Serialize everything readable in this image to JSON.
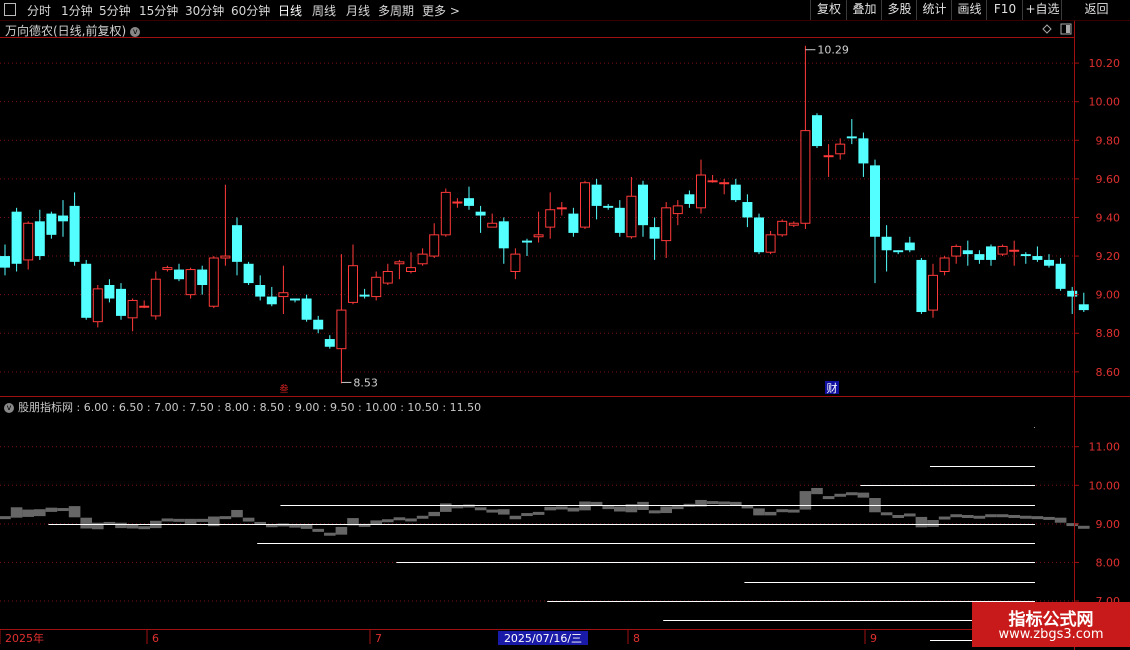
{
  "toolbar": {
    "periods": [
      "分时",
      "1分钟",
      "5分钟",
      "15分钟",
      "30分钟",
      "60分钟",
      "日线",
      "周线",
      "月线",
      "多周期",
      "更多"
    ],
    "active": "日线",
    "right_buttons": [
      "复权",
      "叠加",
      "多股",
      "统计",
      "画线",
      "F10",
      "+自选",
      "返回"
    ]
  },
  "main": {
    "title": "万向德农(日线,前复权)",
    "y_ticks": [
      "10.20",
      "10.00",
      "9.80",
      "9.60",
      "9.40",
      "9.20",
      "9.00",
      "8.80",
      "8.60"
    ],
    "high_label": "10.29",
    "low_label": "8.53",
    "event_marker": "财",
    "cross_marker": "叁",
    "colors": {
      "up": "#ff3a3a",
      "down": "#54ffff",
      "grid": "#7a1010",
      "axis": "#a01010"
    }
  },
  "sub": {
    "title": "股朋指标网 : 6.00 : 6.50 : 7.00 : 7.50 : 8.00 : 8.50 : 9.00 : 9.50 : 10.00 : 10.50 : 11.50",
    "y_ticks": [
      "11.00",
      "10.00",
      "9.00",
      "8.00",
      "7.00"
    ],
    "colors": {
      "bars": "#666666",
      "lines": "#ffffff"
    }
  },
  "x_axis": {
    "labels": [
      "2025年",
      "6",
      "7",
      "8",
      "9"
    ],
    "cursor_date": "2025/07/16/三"
  },
  "watermark": {
    "line1": "指标公式网",
    "line2": "www.zbgs3.com"
  },
  "chart_data": [
    {
      "type": "candlestick",
      "title": "万向德农(日线,前复权)",
      "ylim": [
        8.48,
        10.33
      ],
      "candles": [
        [
          9.2,
          9.14,
          9.26,
          9.1
        ],
        [
          9.43,
          9.16,
          9.45,
          9.12
        ],
        [
          9.18,
          9.37,
          9.38,
          9.13
        ],
        [
          9.38,
          9.2,
          9.44,
          9.18
        ],
        [
          9.42,
          9.31,
          9.43,
          9.29
        ],
        [
          9.41,
          9.38,
          9.49,
          9.3
        ],
        [
          9.46,
          9.17,
          9.53,
          9.15
        ],
        [
          9.16,
          8.88,
          9.18,
          8.87
        ],
        [
          8.86,
          9.03,
          9.05,
          8.83
        ],
        [
          9.05,
          8.98,
          9.08,
          8.96
        ],
        [
          9.03,
          8.89,
          9.06,
          8.87
        ],
        [
          8.88,
          8.97,
          8.98,
          8.81
        ],
        [
          8.94,
          8.94,
          8.97,
          8.93
        ],
        [
          8.89,
          9.08,
          9.12,
          8.87
        ],
        [
          9.13,
          9.14,
          9.15,
          9.12
        ],
        [
          9.13,
          9.08,
          9.16,
          9.07
        ],
        [
          9.0,
          9.13,
          9.14,
          8.98
        ],
        [
          9.13,
          9.05,
          9.15,
          9.0
        ],
        [
          8.94,
          9.19,
          9.2,
          8.93
        ],
        [
          9.19,
          9.2,
          9.57,
          9.15
        ],
        [
          9.36,
          9.17,
          9.4,
          9.1
        ],
        [
          9.16,
          9.06,
          9.17,
          9.05
        ],
        [
          9.05,
          8.99,
          9.1,
          8.97
        ],
        [
          8.99,
          8.95,
          9.04,
          8.94
        ],
        [
          8.99,
          9.01,
          9.15,
          8.9
        ],
        [
          8.98,
          8.97,
          8.98,
          8.96
        ],
        [
          8.98,
          8.87,
          9.0,
          8.86
        ],
        [
          8.87,
          8.82,
          8.89,
          8.8
        ],
        [
          8.77,
          8.73,
          8.79,
          8.72
        ],
        [
          8.72,
          8.92,
          9.21,
          8.54
        ],
        [
          8.96,
          9.15,
          9.26,
          8.95
        ],
        [
          9.0,
          8.99,
          9.03,
          8.98
        ],
        [
          8.99,
          9.09,
          9.12,
          8.97
        ],
        [
          9.06,
          9.12,
          9.16,
          9.05
        ],
        [
          9.16,
          9.17,
          9.18,
          9.08
        ],
        [
          9.12,
          9.14,
          9.22,
          9.11
        ],
        [
          9.16,
          9.21,
          9.24,
          9.15
        ],
        [
          9.2,
          9.31,
          9.37,
          9.19
        ],
        [
          9.31,
          9.53,
          9.55,
          9.3
        ],
        [
          9.48,
          9.48,
          9.5,
          9.45
        ],
        [
          9.5,
          9.46,
          9.56,
          9.44
        ],
        [
          9.43,
          9.41,
          9.46,
          9.32
        ],
        [
          9.35,
          9.37,
          9.42,
          9.36
        ],
        [
          9.38,
          9.24,
          9.4,
          9.16
        ],
        [
          9.12,
          9.21,
          9.24,
          9.08
        ],
        [
          9.28,
          9.27,
          9.29,
          9.2
        ],
        [
          9.3,
          9.31,
          9.43,
          9.27
        ],
        [
          9.35,
          9.44,
          9.53,
          9.29
        ],
        [
          9.45,
          9.45,
          9.48,
          9.41
        ],
        [
          9.42,
          9.32,
          9.45,
          9.3
        ],
        [
          9.35,
          9.58,
          9.59,
          9.34
        ],
        [
          9.57,
          9.46,
          9.6,
          9.39
        ],
        [
          9.46,
          9.45,
          9.47,
          9.44
        ],
        [
          9.45,
          9.32,
          9.49,
          9.3
        ],
        [
          9.3,
          9.51,
          9.61,
          9.29
        ],
        [
          9.57,
          9.36,
          9.59,
          9.3
        ],
        [
          9.35,
          9.29,
          9.4,
          9.18
        ],
        [
          9.28,
          9.45,
          9.48,
          9.19
        ],
        [
          9.42,
          9.46,
          9.49,
          9.36
        ],
        [
          9.52,
          9.47,
          9.54,
          9.45
        ],
        [
          9.45,
          9.62,
          9.7,
          9.42
        ],
        [
          9.59,
          9.59,
          9.62,
          9.58
        ],
        [
          9.58,
          9.58,
          9.6,
          9.52
        ],
        [
          9.57,
          9.49,
          9.6,
          9.48
        ],
        [
          9.48,
          9.4,
          9.52,
          9.35
        ],
        [
          9.4,
          9.22,
          9.42,
          9.21
        ],
        [
          9.22,
          9.31,
          9.33,
          9.21
        ],
        [
          9.31,
          9.38,
          9.39,
          9.3
        ],
        [
          9.36,
          9.37,
          9.38,
          9.35
        ],
        [
          9.37,
          9.85,
          10.29,
          9.34
        ],
        [
          9.93,
          9.77,
          9.94,
          9.76
        ],
        [
          9.72,
          9.72,
          9.78,
          9.61
        ],
        [
          9.73,
          9.78,
          9.81,
          9.7
        ],
        [
          9.82,
          9.81,
          9.91,
          9.78
        ],
        [
          9.81,
          9.68,
          9.84,
          9.61
        ],
        [
          9.67,
          9.3,
          9.7,
          9.06
        ],
        [
          9.3,
          9.23,
          9.36,
          9.12
        ],
        [
          9.23,
          9.22,
          9.23,
          9.21
        ],
        [
          9.27,
          9.23,
          9.3,
          9.22
        ],
        [
          9.18,
          8.91,
          9.19,
          8.9
        ],
        [
          8.92,
          9.1,
          9.16,
          8.88
        ],
        [
          9.12,
          9.19,
          9.2,
          9.1
        ],
        [
          9.2,
          9.25,
          9.26,
          9.16
        ],
        [
          9.23,
          9.21,
          9.28,
          9.15
        ],
        [
          9.21,
          9.18,
          9.23,
          9.16
        ],
        [
          9.25,
          9.18,
          9.26,
          9.15
        ],
        [
          9.21,
          9.25,
          9.26,
          9.2
        ],
        [
          9.23,
          9.23,
          9.28,
          9.15
        ],
        [
          9.21,
          9.2,
          9.22,
          9.16
        ],
        [
          9.2,
          9.18,
          9.25,
          9.17
        ],
        [
          9.18,
          9.15,
          9.21,
          9.14
        ],
        [
          9.16,
          9.03,
          9.19,
          9.02
        ],
        [
          9.02,
          8.99,
          9.04,
          8.9
        ],
        [
          8.95,
          8.92,
          9.01,
          8.91
        ]
      ]
    },
    {
      "type": "bar",
      "title": "股朋指标网",
      "ylim": [
        6.3,
        11.9
      ],
      "levels": [
        6.0,
        6.5,
        7.0,
        7.5,
        8.0,
        8.5,
        9.0,
        9.5,
        10.0,
        10.5,
        11.5
      ],
      "horizontal_lines": [
        {
          "value": 11.5,
          "from_index": 89
        },
        {
          "value": 10.5,
          "from_index": 80
        },
        {
          "value": 10.0,
          "from_index": 74
        },
        {
          "value": 9.5,
          "from_index": 24
        },
        {
          "value": 9.0,
          "from_index": 4
        },
        {
          "value": 8.5,
          "from_index": 22
        },
        {
          "value": 8.0,
          "from_index": 34
        },
        {
          "value": 7.5,
          "from_index": 64
        },
        {
          "value": 7.0,
          "from_index": 47
        },
        {
          "value": 6.5,
          "from_index": 57
        },
        {
          "value": 6.0,
          "from_index": 80
        }
      ]
    }
  ]
}
